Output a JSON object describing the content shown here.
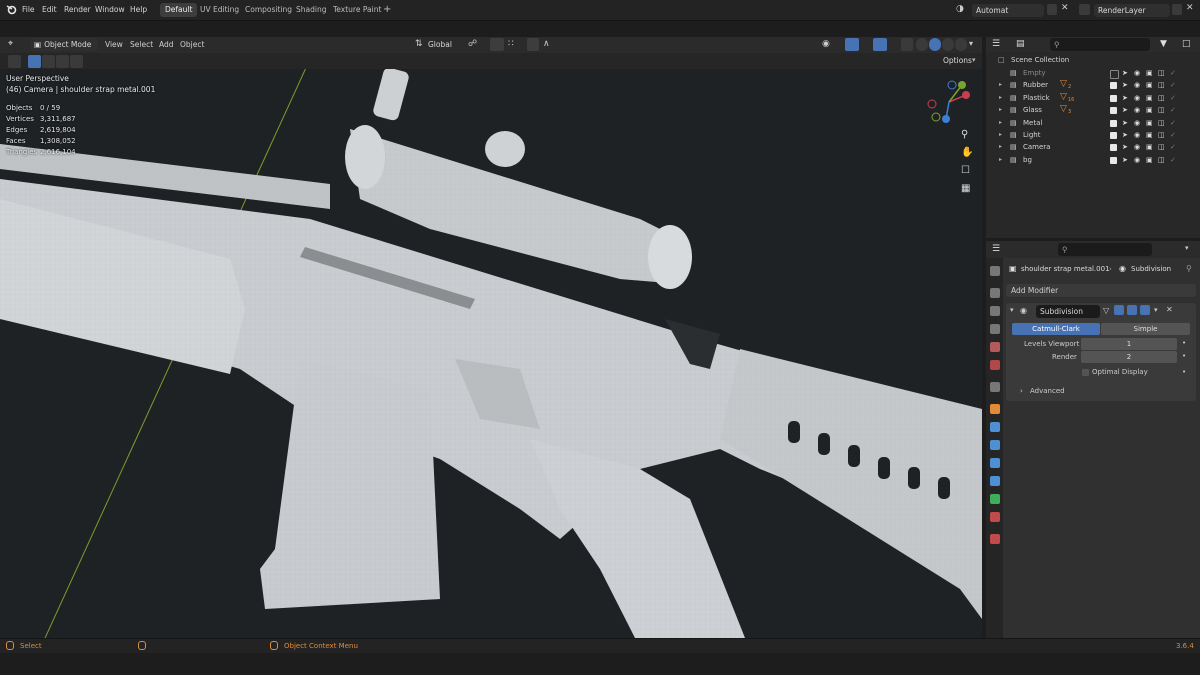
{
  "topbar": {
    "menus": [
      "File",
      "Edit",
      "Render",
      "Window",
      "Help"
    ],
    "workspaces": [
      "Default",
      "UV Editing",
      "Compositing",
      "Shading",
      "Texture Paint"
    ],
    "scene_value": "Automat",
    "view_layer_value": "RenderLayer"
  },
  "viewport_header": {
    "mode": "Object Mode",
    "menus": [
      "View",
      "Select",
      "Add",
      "Object"
    ],
    "transform_orientation": "Global",
    "options_label": "Options"
  },
  "overlay": {
    "view_name": "User Perspective",
    "object_info": "(46) Camera | shoulder strap metal.001",
    "stats": [
      {
        "label": "Objects",
        "value": "0 / 59"
      },
      {
        "label": "Vertices",
        "value": "3,311,687"
      },
      {
        "label": "Edges",
        "value": "2,619,804"
      },
      {
        "label": "Faces",
        "value": "1,308,052"
      },
      {
        "label": "Triangles",
        "value": "2,616,104"
      }
    ]
  },
  "outliner": {
    "root": "Scene Collection",
    "items": [
      {
        "name": "Empty",
        "badge": "",
        "dim": true
      },
      {
        "name": "Rubber",
        "badge": "2",
        "dim": false
      },
      {
        "name": "Plastick",
        "badge": "16",
        "dim": false
      },
      {
        "name": "Glass",
        "badge": "3",
        "dim": false
      },
      {
        "name": "Metal",
        "badge": "",
        "dim": false
      },
      {
        "name": "Light",
        "badge": "",
        "dim": false
      },
      {
        "name": "Camera",
        "badge": "",
        "dim": false
      },
      {
        "name": "bg",
        "badge": "",
        "dim": false
      }
    ]
  },
  "properties": {
    "object_name": "shoulder strap metal.001",
    "modifier_name_crumb": "Subdivision",
    "add_modifier": "Add Modifier",
    "modifier_name": "Subdivision",
    "mode_catmull": "Catmull-Clark",
    "mode_simple": "Simple",
    "levels_viewport_label": "Levels Viewport",
    "levels_viewport_value": "1",
    "render_label": "Render",
    "render_value": "2",
    "optimal_display": "Optimal Display",
    "advanced": "Advanced"
  },
  "statusbar": {
    "select": "Select",
    "context_menu": "Object Context Menu",
    "version": "3.6.4"
  },
  "colors": {
    "accent_blue": "#4772b3",
    "orange": "#e08a3a",
    "x_axis": "#8a2f37",
    "y_axis": "#7d9c2c"
  }
}
